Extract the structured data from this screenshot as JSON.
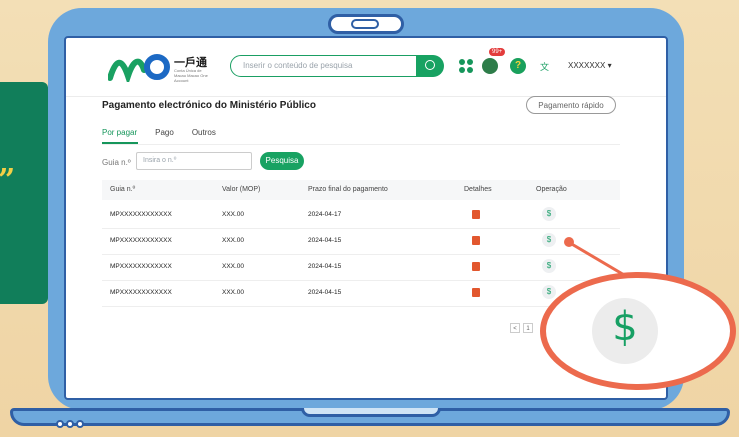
{
  "quote_mark": "”",
  "header": {
    "logo_title": "一戶通",
    "logo_sub": "Conta Única de Macau Macao One Account",
    "search_placeholder": "Inserir o conteúdo de pesquisa",
    "notification_badge": "99+",
    "user_name": "XXXXXXX ▾"
  },
  "page": {
    "title": "Pagamento electrónico do Ministério Público",
    "quick_pay_label": "Pagamento rápido",
    "tabs": [
      {
        "label": "Por pagar",
        "active": true
      },
      {
        "label": "Pago",
        "active": false
      },
      {
        "label": "Outros",
        "active": false
      }
    ],
    "search_label": "Guia n.º",
    "search_input_placeholder": "Insira o n.º",
    "search_button": "Pesquisa"
  },
  "table": {
    "headers": [
      "Guia n.º",
      "Valor (MOP)",
      "Prazo final do pagamento",
      "Detalhes",
      "Operação"
    ],
    "rows": [
      {
        "guia": "MPXXXXXXXXXXXX",
        "valor": "XXX.00",
        "prazo": "2024-04-17",
        "op": "$"
      },
      {
        "guia": "MPXXXXXXXXXXXX",
        "valor": "XXX.00",
        "prazo": "2024-04-15",
        "op": "$"
      },
      {
        "guia": "MPXXXXXXXXXXXX",
        "valor": "XXX.00",
        "prazo": "2024-04-15",
        "op": "$"
      },
      {
        "guia": "MPXXXXXXXXXXXX",
        "valor": "XXX.00",
        "prazo": "2024-04-15",
        "op": "$"
      }
    ]
  },
  "pagination": {
    "prev": "<",
    "current": "1"
  },
  "zoom": {
    "symbol": "$"
  },
  "colors": {
    "primary_green": "#18a262",
    "laptop_blue": "#6da8dc",
    "outline_blue": "#2f5fa5",
    "highlight_coral": "#ec6a4d",
    "pdf_red": "#e2572e",
    "side_card_green": "#117e5a",
    "quote_yellow": "#f2cf46"
  },
  "icons": [
    "search-icon",
    "apps-grid-icon",
    "notification-icon",
    "help-icon",
    "language-icon",
    "pdf-icon",
    "dollar-icon"
  ]
}
